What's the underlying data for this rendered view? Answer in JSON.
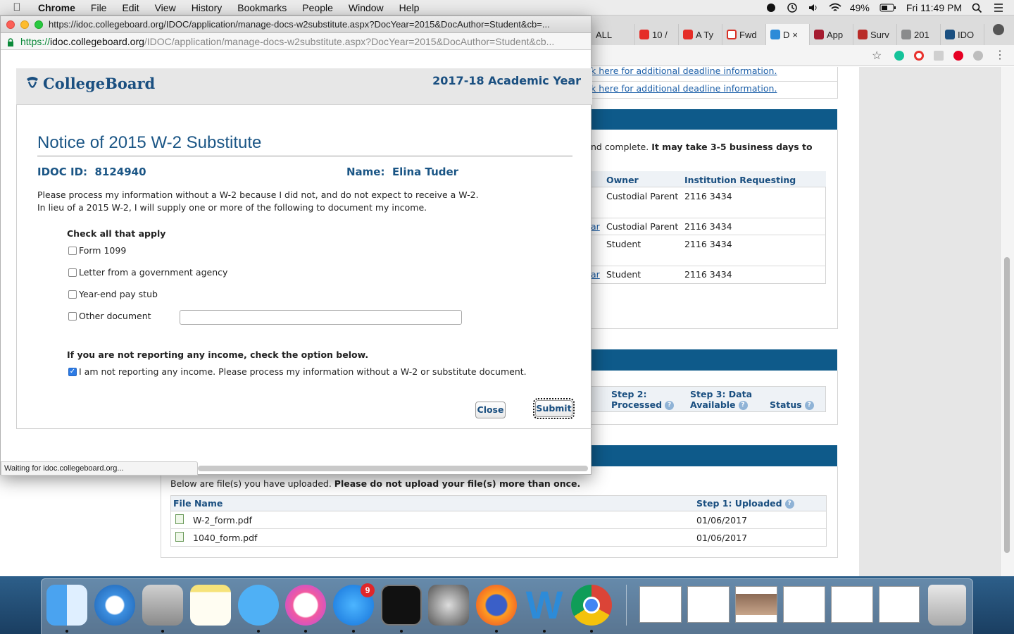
{
  "menubar": {
    "app": "Chrome",
    "items": [
      "File",
      "Edit",
      "View",
      "History",
      "Bookmarks",
      "People",
      "Window",
      "Help"
    ],
    "battery": "49%",
    "clock": "Fri 11:49 PM"
  },
  "background_browser": {
    "tabs": [
      "ALL",
      "10 /",
      "A Ty",
      "Fwd",
      "D",
      "App",
      "Surv",
      "201",
      "IDO"
    ],
    "links": [
      "k here for additional deadline information.",
      "k here for additional deadline information."
    ],
    "notice_text": "nd complete.",
    "notice_bold": "It may take 3-5 business days to",
    "docs_table": {
      "headers": [
        "Owner",
        "Institution Requesting"
      ],
      "rows": [
        {
          "link": "",
          "owner": "Custodial Parent",
          "inst": "2116  3434"
        },
        {
          "link": "ar",
          "owner": "Custodial Parent",
          "inst": "2116  3434"
        },
        {
          "link": "",
          "owner": "Student",
          "inst": "2116  3434"
        },
        {
          "link": "ar",
          "owner": "Student",
          "inst": "2116  3434"
        }
      ]
    },
    "steps_headers": [
      "Step 2: Processed",
      "Step 3: Data Available",
      "Status"
    ],
    "uploads_intro": "Below are file(s) you have uploaded.",
    "uploads_intro_bold": "Please do not upload your file(s) more than once.",
    "uploads_table": {
      "headers": [
        "File Name",
        "Step 1: Uploaded"
      ],
      "rows": [
        {
          "name": "W-2_form.pdf",
          "date": "01/06/2017"
        },
        {
          "name": "1040_form.pdf",
          "date": "01/06/2017"
        }
      ]
    }
  },
  "popup": {
    "window_title": "https://idoc.collegeboard.org/IDOC/application/manage-docs-w2substitute.aspx?DocYear=2015&DocAuthor=Student&cb=...",
    "url_scheme": "https://",
    "url_host": "idoc.collegeboard.org",
    "url_path": "/IDOC/application/manage-docs-w2substitute.aspx?DocYear=2015&DocAuthor=Student&cb...",
    "logo_text": "CollegeBoard",
    "academic_year": "2017-18 Academic Year",
    "title": "Notice of 2015 W-2 Substitute",
    "idoc_label": "IDOC ID:",
    "idoc_value": "8124940",
    "name_label": "Name:",
    "name_value": "Elina  Tuder",
    "para1": "Please process my information without a W-2 because I did not, and do not expect to receive a W-2.",
    "para2": "In lieu of a 2015 W-2, I will supply one or more of the following to document my income.",
    "check_heading": "Check all that apply",
    "options": [
      {
        "label": "Form 1099",
        "checked": false
      },
      {
        "label": "Letter from a government agency",
        "checked": false
      },
      {
        "label": "Year-end pay stub",
        "checked": false
      },
      {
        "label": "Other document",
        "checked": false
      }
    ],
    "other_value": "",
    "no_income_heading": "If you are not reporting any income, check the option below.",
    "no_income_label": "I am not reporting any income. Please process my information without a W-2 or substitute document.",
    "no_income_checked": true,
    "close_label": "Close",
    "submit_label": "Submit",
    "status_text": "Waiting for idoc.collegeboard.org..."
  },
  "dock": {
    "apps": [
      "Finder",
      "Safari",
      "Calculator",
      "Notes",
      "Messages",
      "iTunes",
      "App Store",
      "Activity Monitor",
      "System Preferences",
      "Firefox",
      "Word",
      "Chrome"
    ],
    "app_store_badge": "9"
  }
}
